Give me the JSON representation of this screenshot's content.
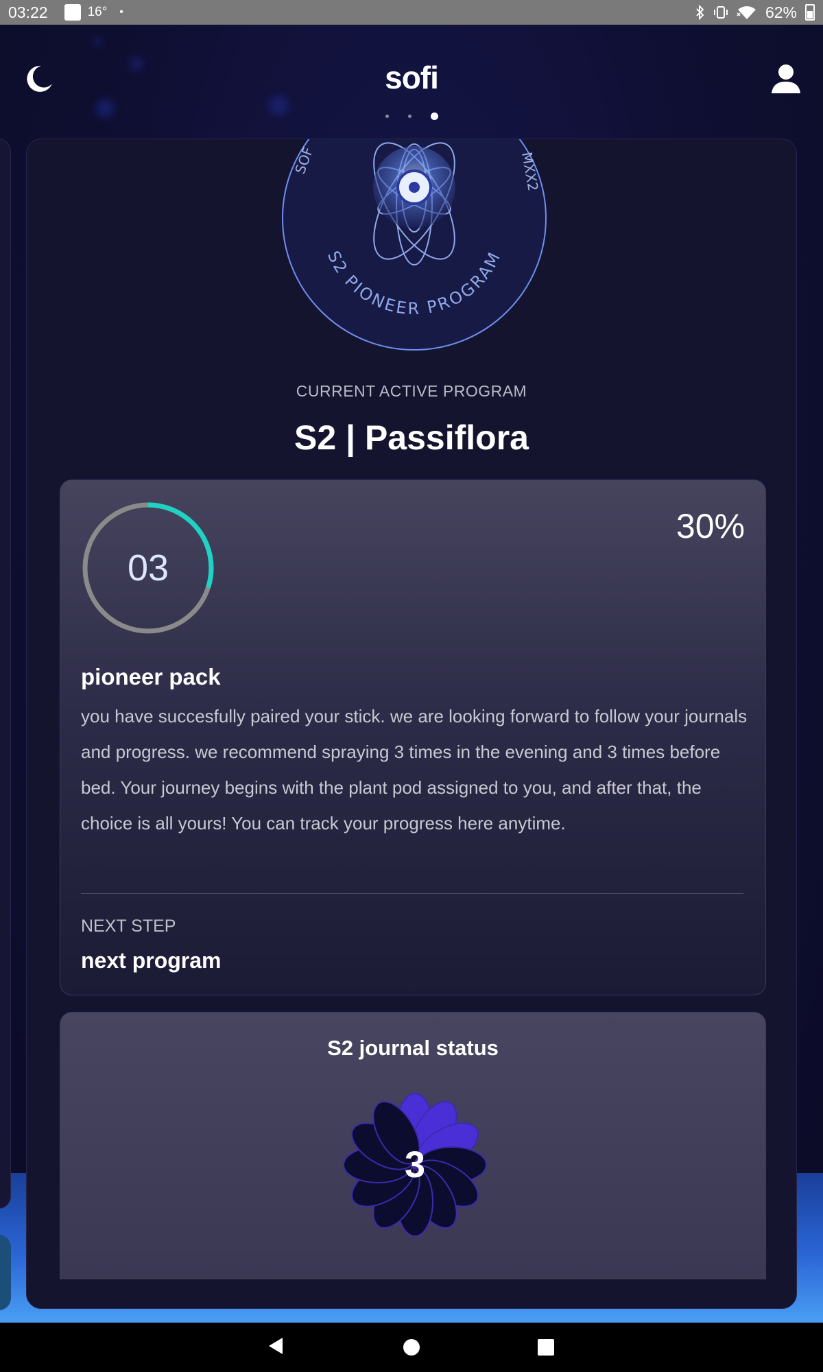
{
  "status_bar": {
    "time": "03:22",
    "temperature": "16°",
    "dot": "•",
    "battery": "62%",
    "icons": [
      "bluetooth-icon",
      "vibrate-icon",
      "wifi-icon",
      "battery-icon"
    ]
  },
  "header": {
    "logo": "sofi",
    "left_icon": "moon-icon",
    "right_icon": "profile-icon",
    "pager": {
      "pages": 3,
      "active": 3
    }
  },
  "program": {
    "seal": {
      "top_left_text": "SOF",
      "top_right_text": "MXX2",
      "bottom_text": "S2 PIONEER PROGRAM"
    },
    "kicker": "CURRENT ACTIVE PROGRAM",
    "title": "S2 | Passiflora"
  },
  "progress_card": {
    "ring_number": "03",
    "ring_progress_fraction": 0.3,
    "percent": "30%",
    "pack_title": "pioneer pack",
    "pack_description": "you have succesfully paired your stick. we are looking forward to follow your journals and progress. we recommend spraying 3 times in the evening and 3 times before bed. Your journey begins with the plant pod assigned to you, and after that, the choice is all yours! You can track your progress here anytime.",
    "next_step_kicker": "NEXT STEP",
    "next_step_value": "next program"
  },
  "journal_card": {
    "title": "S2 journal status",
    "count": "3",
    "petals_total": 12,
    "petals_filled": 3
  },
  "colors": {
    "accent_ring": "#1ed3c3",
    "ring_track": "#8a8a8a",
    "petal_filled": "#4a2fd6",
    "petal_empty": "#0c0c2e",
    "bottom_glow": "#4aa0f5"
  },
  "nav_bar": {
    "icons": [
      "back-icon",
      "home-icon",
      "recents-icon"
    ]
  }
}
